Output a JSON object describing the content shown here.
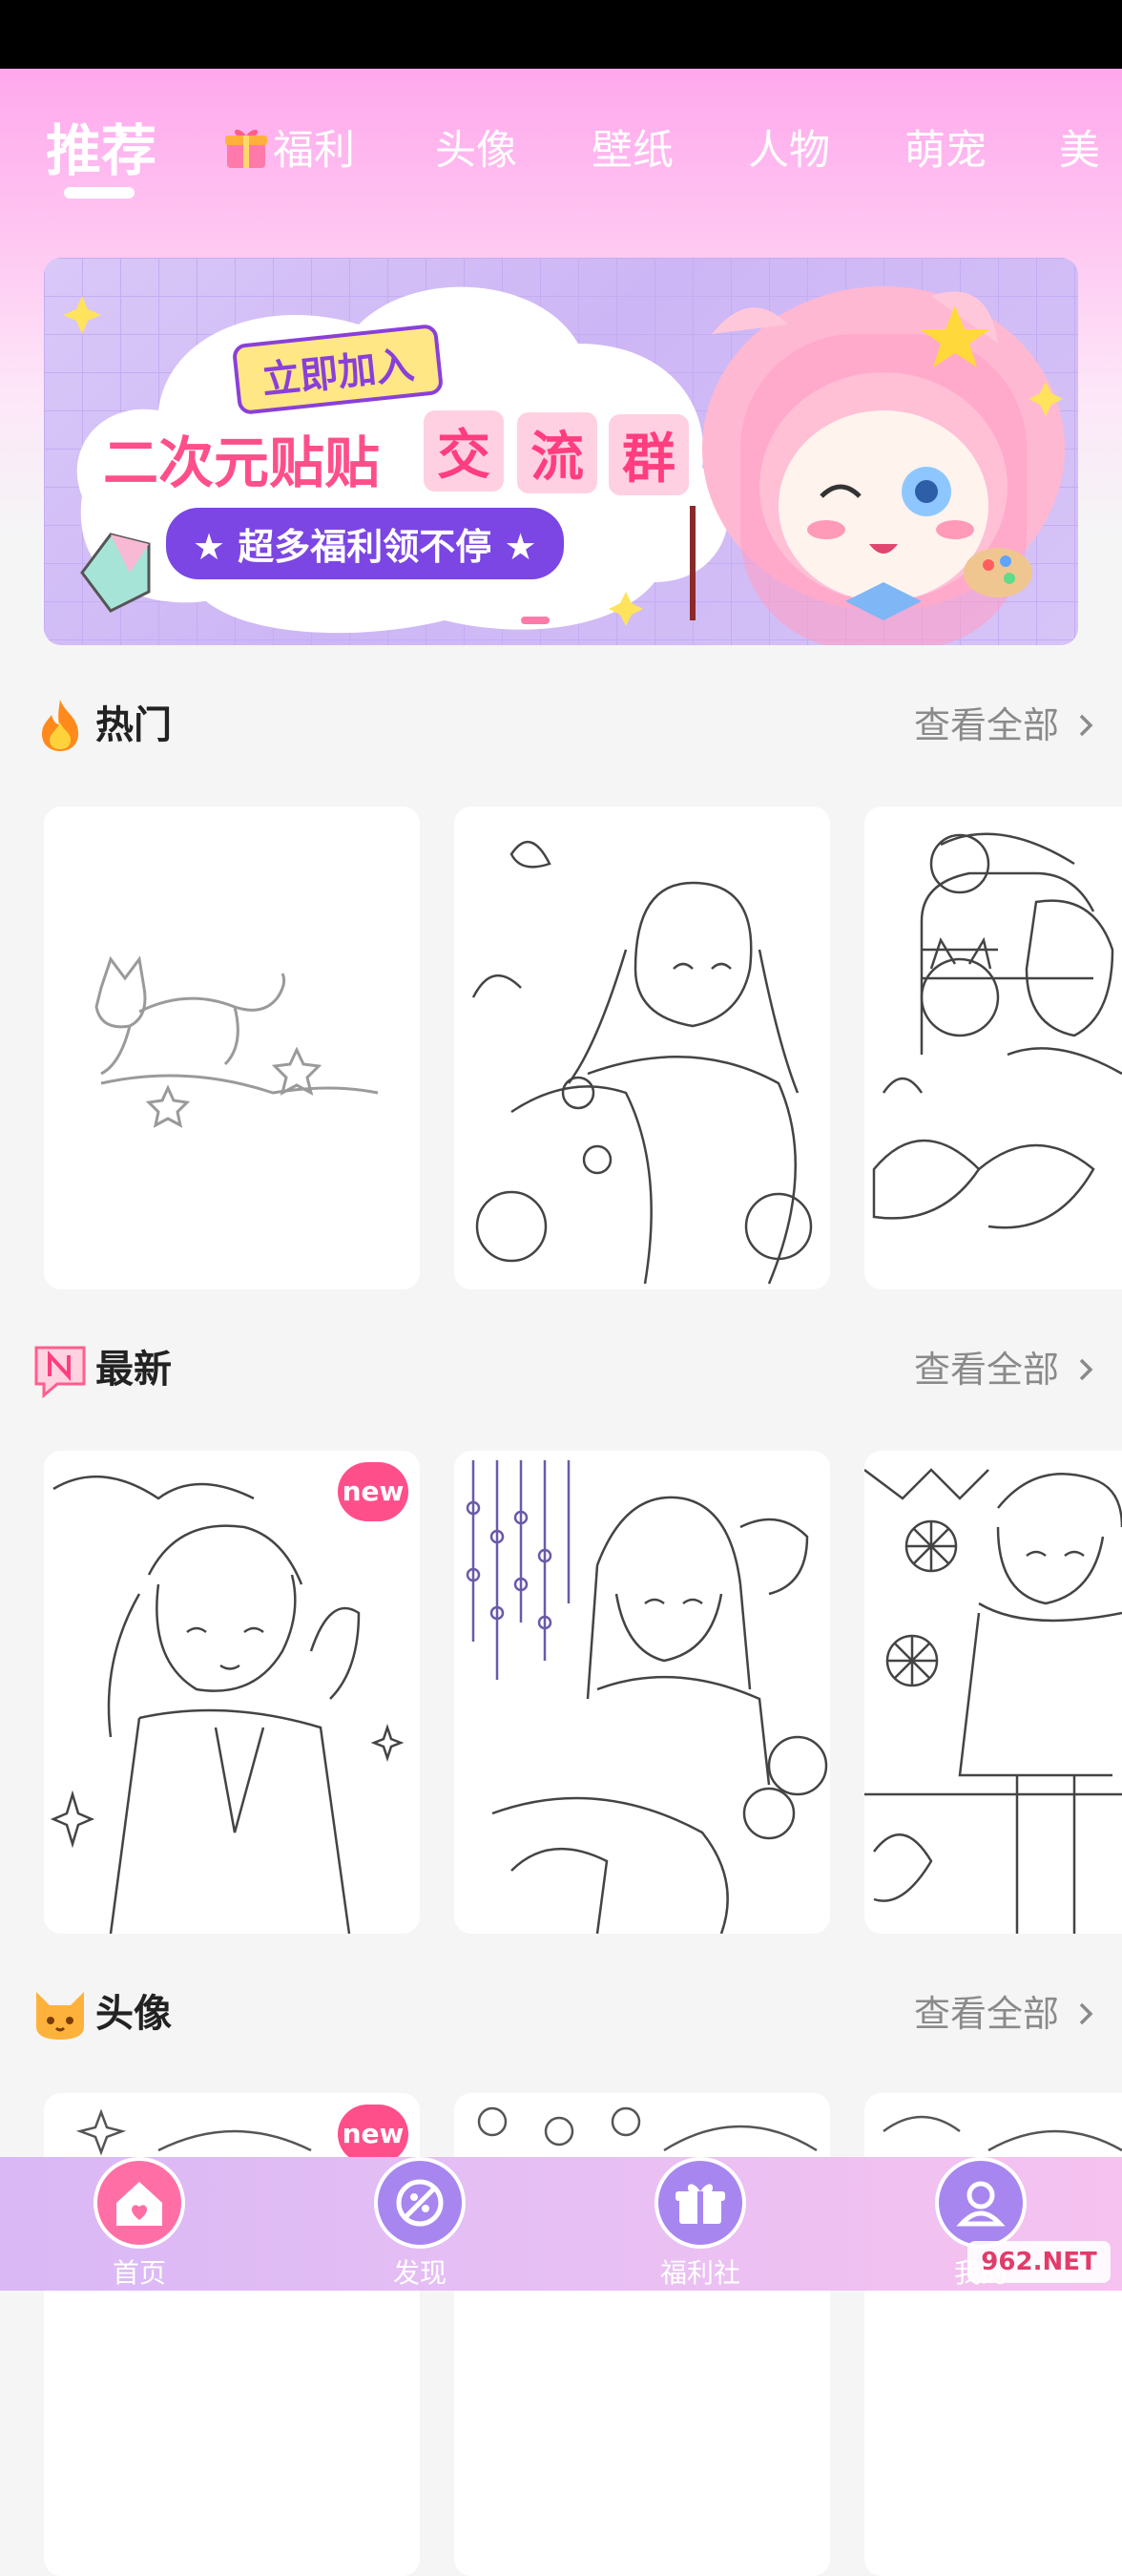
{
  "tabs": [
    {
      "label": "推荐",
      "active": true
    },
    {
      "label": "福利",
      "active": false,
      "icon": "gift-icon"
    },
    {
      "label": "头像",
      "active": false
    },
    {
      "label": "壁纸",
      "active": false
    },
    {
      "label": "人物",
      "active": false
    },
    {
      "label": "萌宠",
      "active": false
    },
    {
      "label": "美",
      "active": false
    }
  ],
  "banner": {
    "tag": "立即加入",
    "headline_left": "二次元贴贴",
    "headline_boxes": [
      "交",
      "流",
      "群"
    ],
    "subline": "★ 超多福利领不停 ★"
  },
  "sections": [
    {
      "title": "热门",
      "more": "查看全部",
      "icon": "fire-icon"
    },
    {
      "title": "最新",
      "more": "查看全部",
      "icon": "new-n-icon"
    },
    {
      "title": "头像",
      "more": "查看全部",
      "icon": "cat-face-icon"
    }
  ],
  "badges": {
    "new": "new"
  },
  "nav": [
    {
      "label": "首页",
      "icon": "home-icon",
      "active": true
    },
    {
      "label": "发现",
      "icon": "compass-icon",
      "active": false
    },
    {
      "label": "福利社",
      "icon": "gift-icon",
      "active": false
    },
    {
      "label": "我的",
      "icon": "user-icon",
      "active": false
    }
  ],
  "watermark": "962.NET",
  "colors": {
    "accent_pink": "#ff4f8a",
    "header_pink": "#ffa8ec",
    "nav_purple": "#a886f0"
  }
}
